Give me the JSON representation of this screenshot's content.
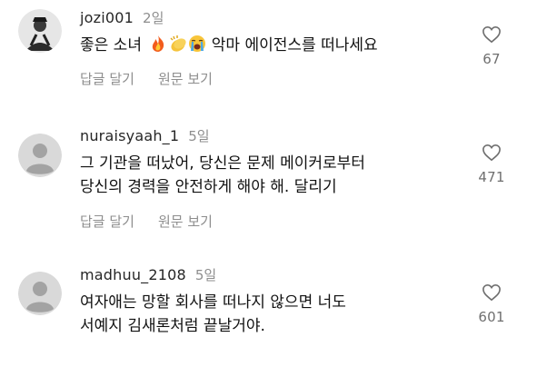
{
  "comments": [
    {
      "username": "jozi001",
      "time": "2일",
      "text_before_emoji": "좋은 소녀",
      "emojis": [
        "fire-emoji",
        "clapping-hands-emoji",
        "loudly-crying-face-emoji"
      ],
      "text_after_emoji": "악마 에이전스를 떠나세요",
      "reply_label": "답글 달기",
      "translate_label": "원문 보기",
      "likes": "67",
      "avatar": "photo"
    },
    {
      "username": "nuraisyaah_1",
      "time": "5일",
      "lines": [
        "그 기관을 떠났어, 당신은 문제 메이커로부터",
        "당신의 경력을 안전하게 해야 해. 달리기"
      ],
      "reply_label": "답글 달기",
      "translate_label": "원문 보기",
      "likes": "471",
      "avatar": "default"
    },
    {
      "username": "madhuu_2108",
      "time": "5일",
      "lines": [
        "여자애는 망할 회사를 떠나지 않으면 너도",
        "서예지 김새론처럼 끝날거야."
      ],
      "likes": "601",
      "avatar": "default"
    }
  ],
  "colors": {
    "text": "#111111",
    "secondary": "#8e8e8e",
    "default_avatar_bg": "#d9d9d9",
    "default_avatar_fg": "#a0a0a0"
  }
}
